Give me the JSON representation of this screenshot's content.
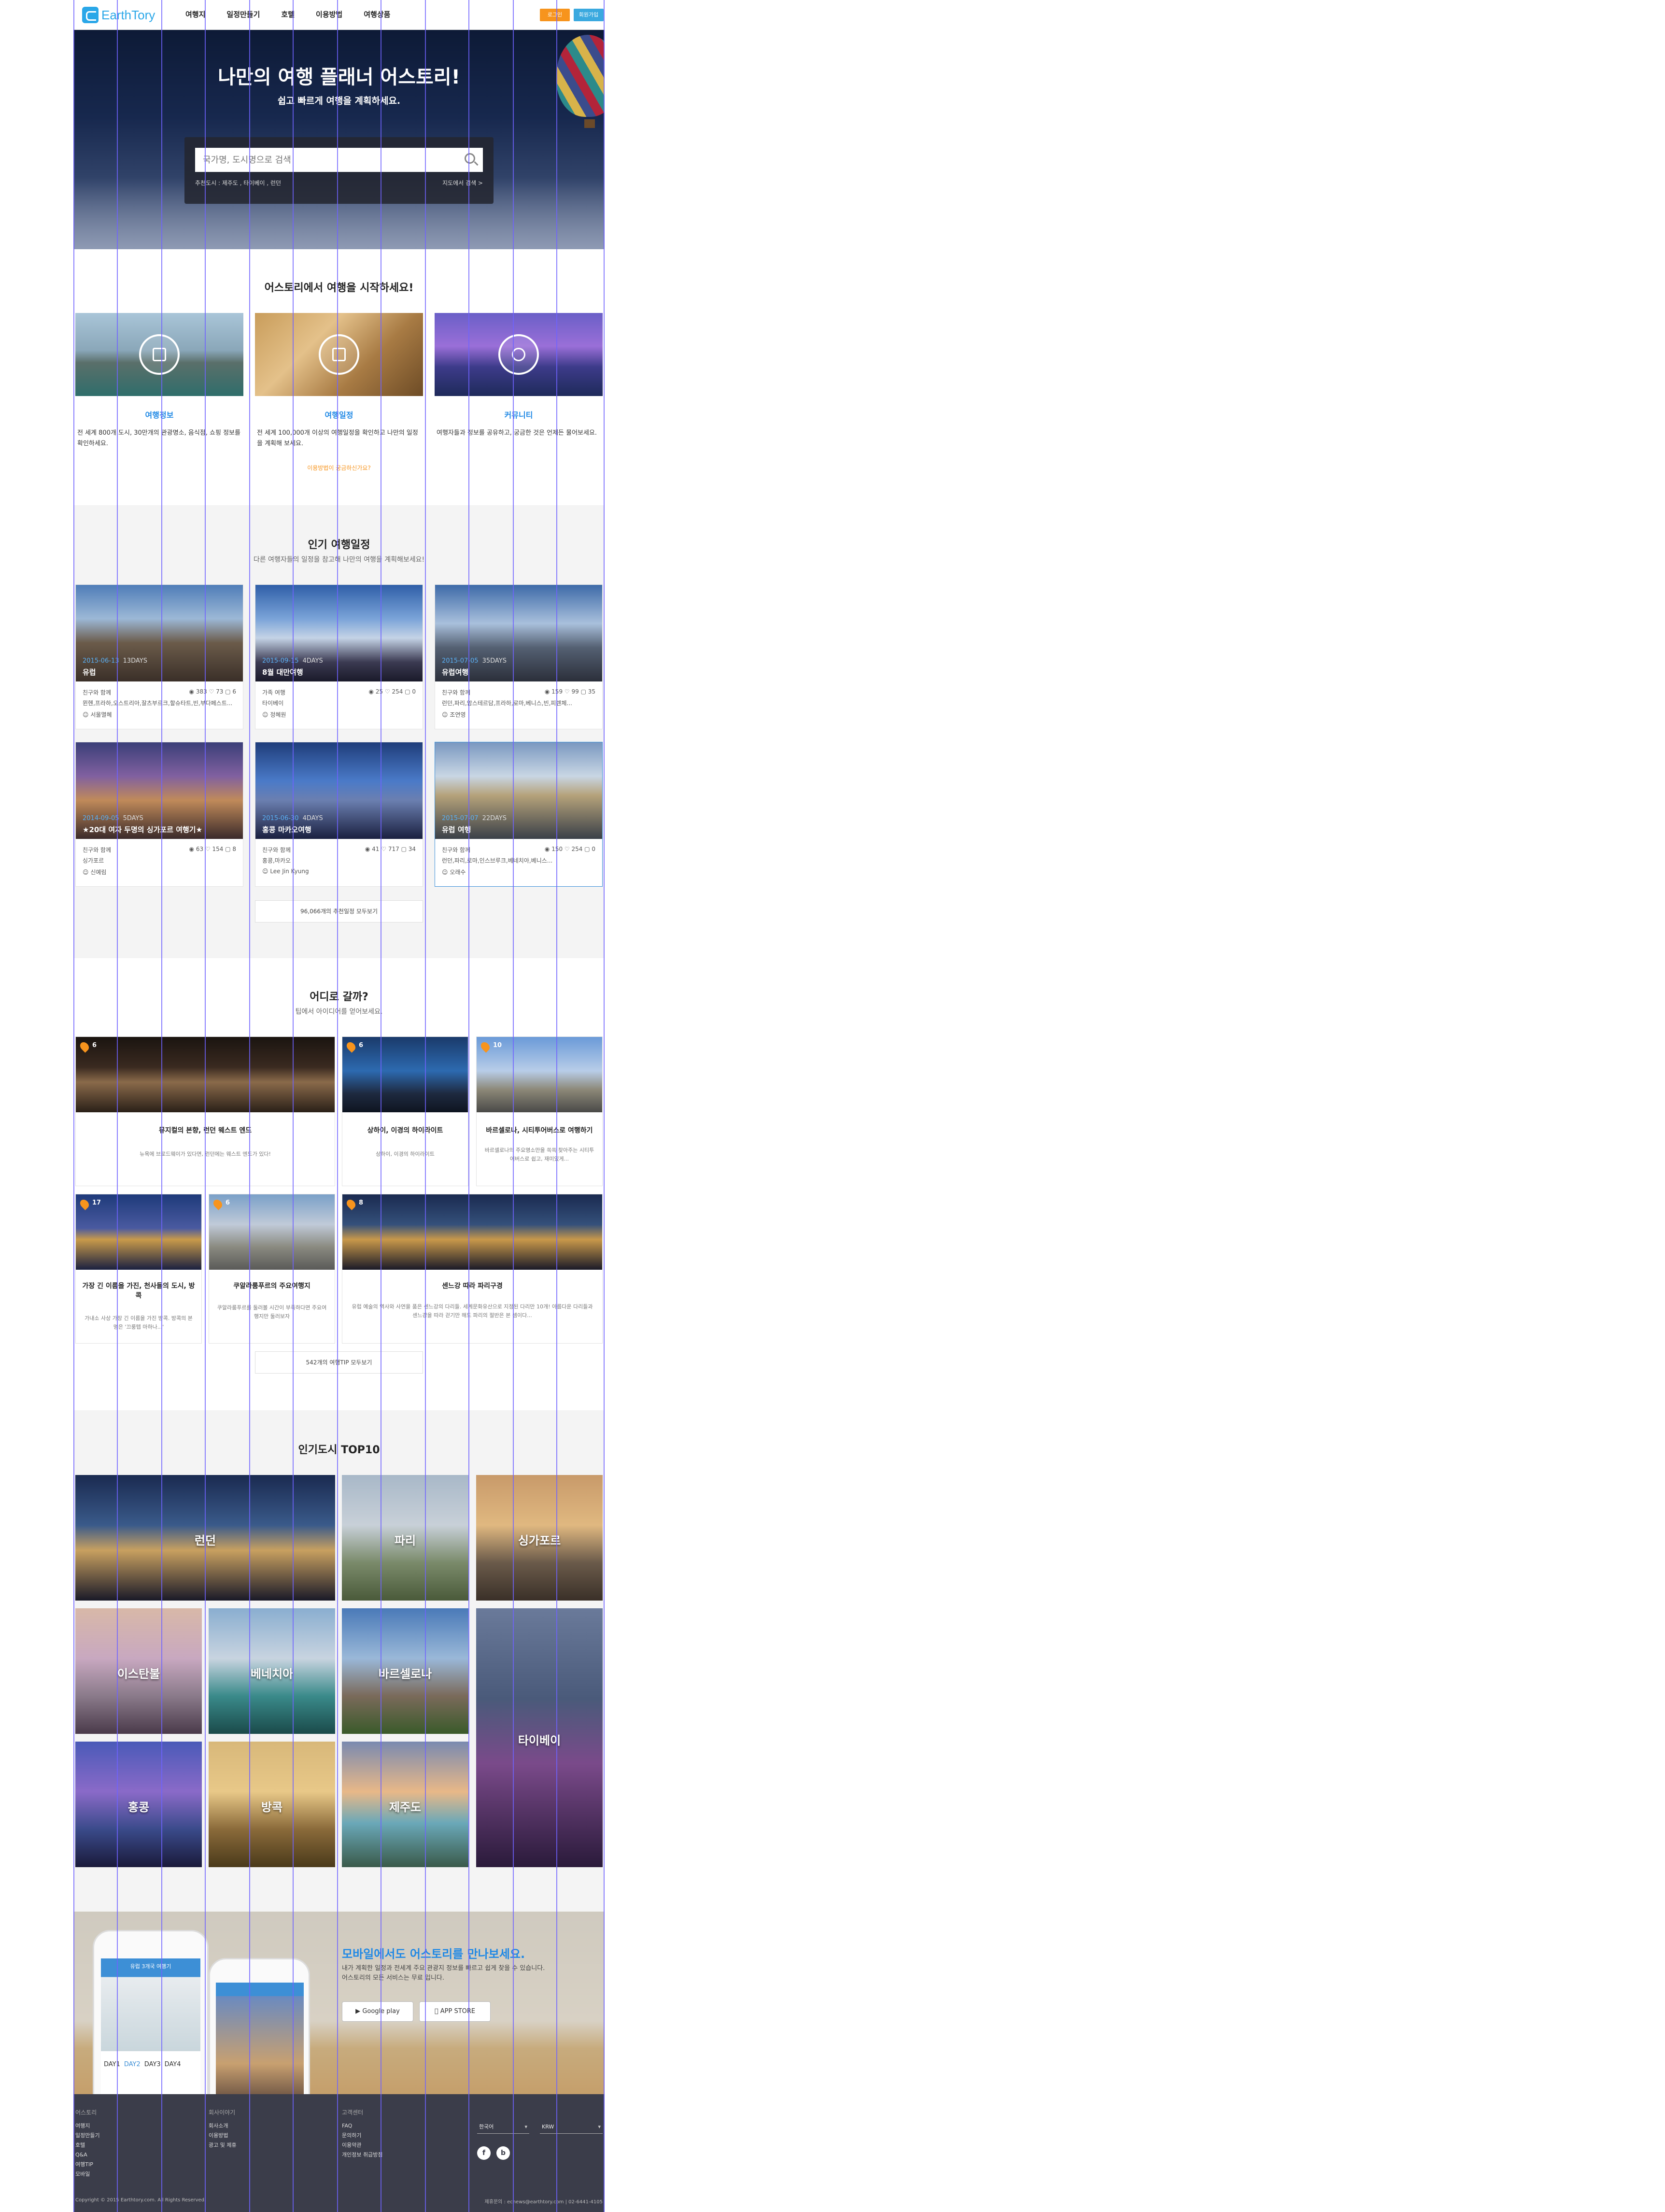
{
  "brand": {
    "name": "EarthTory",
    "color": "#2aa7e8"
  },
  "nav": [
    "여행지",
    "일정만들기",
    "호텔",
    "이용방법",
    "여행상품"
  ],
  "auth": {
    "login": "로그인",
    "join": "회원가입"
  },
  "hero": {
    "title": "나만의 여행 플래너 어스토리!",
    "subtitle": "쉽고 빠르게 여행을 계획하세요.",
    "search_placeholder": "국가명, 도시명으로 검색",
    "recommended": "추천도시 : 제주도 , 타이베이 , 런던",
    "map_search": "지도에서 검색 >"
  },
  "start": {
    "title": "어스토리에서 여행을 시작하세요!",
    "features": [
      {
        "title": "여행정보",
        "desc": "전 세계 800개 도시, 30만개의 관광명소, 음식점, 쇼핑 정보를 확인하세요."
      },
      {
        "title": "여행일정",
        "desc": "전 세계 100,000개 이상의 여행일정을 확인하고 나만의 일정을 계획해 보세요."
      },
      {
        "title": "커뮤니티",
        "desc": "여행자들과 정보를 공유하고, 궁금한 것은 언제든 물어보세요."
      }
    ],
    "help_link": "이용방법이 궁금하신가요?"
  },
  "popular": {
    "title": "인기 여행일정",
    "subtitle": "다른 여행자들의 일정을 참고해 나만의 여행을 계획해보세요!",
    "cards": [
      {
        "date": "2015-06-13",
        "days": "13DAYS",
        "title": "유럽",
        "who": "친구와 함께",
        "route": "뮌헨,프라하,오스트리아,잘츠부르크,할슈타트,빈,부다페스트...",
        "author": "서울멸혜",
        "s1": "383",
        "s2": "73",
        "s3": "6"
      },
      {
        "date": "2015-09-15",
        "days": "4DAYS",
        "title": "8월 대만여행",
        "who": "가족 여행",
        "route": "타이베이",
        "author": "정혜원",
        "s1": "25",
        "s2": "254",
        "s3": "0"
      },
      {
        "date": "2015-07-05",
        "days": "35DAYS",
        "title": "유럽여행",
        "who": "친구와 함께",
        "route": "런던,파리,암스테르담,프라하,로마,베니스,빈,피렌체...",
        "author": "조연영",
        "s1": "159",
        "s2": "99",
        "s3": "35"
      },
      {
        "date": "2014-09-05",
        "days": "5DAYS",
        "title": "★20대 여자 두명의 싱가포르 여행기★",
        "who": "친구와 함께",
        "route": "싱가포르",
        "author": "신예림",
        "s1": "63",
        "s2": "154",
        "s3": "8"
      },
      {
        "date": "2015-06-30",
        "days": "4DAYS",
        "title": "홍콩 마카오여행",
        "who": "친구와 함께",
        "route": "홍콩,마카오",
        "author": "Lee Jin Kyung",
        "s1": "41",
        "s2": "717",
        "s3": "34"
      },
      {
        "date": "2015-07-07",
        "days": "22DAYS",
        "title": "유럽 여행",
        "who": "친구와 함께",
        "route": "런던,파리,로마,인스브루크,베네치아,베니스...",
        "author": "오래수",
        "s1": "150",
        "s2": "254",
        "s3": "0"
      }
    ],
    "more": "96,066개의 추천일정 모두보기"
  },
  "where": {
    "title": "어디로 갈까?",
    "subtitle": "팁에서 아이디어를 얻어보세요.",
    "tips": [
      {
        "num": "6",
        "title": "뮤지컬의 본향, 런던 웨스트 엔드",
        "desc": "뉴욕에 브로드웨이가 있다면, 런던에는 웨스트 엔드가 있다!"
      },
      {
        "num": "6",
        "title": "상하이, 이경의 하이라이트",
        "desc": "상하이, 이경의 하이라이트"
      },
      {
        "num": "10",
        "title": "바르셀로나, 시티투어버스로 여행하기",
        "desc": "바르셀로나의 주요명소만을 쏙쏙 찾아주는 시티투어버스로 쉽고, 재미있게..."
      },
      {
        "num": "17",
        "title": "가장 긴 이름을 가진, 천사들의 도시, 방콕",
        "desc": "가내소 사상 가장 긴 이름을 가진 방콕. 방콕의 본명은 '끄룽텝 마하나...'"
      },
      {
        "num": "6",
        "title": "쿠알라룸푸르의 주요여행지",
        "desc": "쿠알라룸푸르를 둘러볼 시간이 부족하다면 주요여행지만 둘러보자"
      },
      {
        "num": "8",
        "title": "센느강 따라 파리구경",
        "desc": "유럽 예술의 역사와 사연을 품은 센느강의 다리들. 세계문화유산으로 지정된 다리만 10개! 아름다운 다리들과 센느강을 따라 걷기만 해도 파리의 절반은 본 셈이다..."
      }
    ],
    "more": "542개의 여행TIP 모두보기"
  },
  "top10": {
    "title": "인기도시 TOP10",
    "cities": [
      "런던",
      "파리",
      "싱가포르",
      "이스탄불",
      "베네치아",
      "바르셀로나",
      "타이베이",
      "홍콩",
      "방콕",
      "제주도"
    ]
  },
  "mobile": {
    "title": "모바일에서도 어스토리를 만나보세요.",
    "desc1": "내가 계획한 일정과 전세계 주요 관광지 정보를 빠르고 쉽게 찾을 수 있습니다.",
    "desc2": "어스토리의 모든 서비스는 무료 입니다.",
    "google": "Google play",
    "apple": "APP STORE",
    "days": [
      "DAY1",
      "DAY2",
      "DAY3",
      "DAY4"
    ],
    "phone_title": "유럽 3개국 여행기"
  },
  "footer": {
    "col1": {
      "title": "어스토리",
      "items": [
        "여행지",
        "일정만들기",
        "호텔",
        "Q&A",
        "여행TIP",
        "모바일"
      ]
    },
    "col2": {
      "title": "회사이야기",
      "items": [
        "회사소개",
        "이용방법",
        "광고 및 제휴"
      ]
    },
    "col3": {
      "title": "고객센터",
      "items": [
        "FAQ",
        "문의하기",
        "이용약관",
        "개인정보 취급방침"
      ]
    },
    "lang": "한국어",
    "currency": "KRW",
    "copyright": "Copyright © 2015 Earthtory.com. All Rights Reserved.",
    "contact": "제휴문의 : ecnews@earthtory.com | 02-6441-4105"
  },
  "colors": {
    "accent": "#1e88e5",
    "orange": "#f7941d",
    "guide": "#6f63ff",
    "footer": "#3b3d4a"
  }
}
